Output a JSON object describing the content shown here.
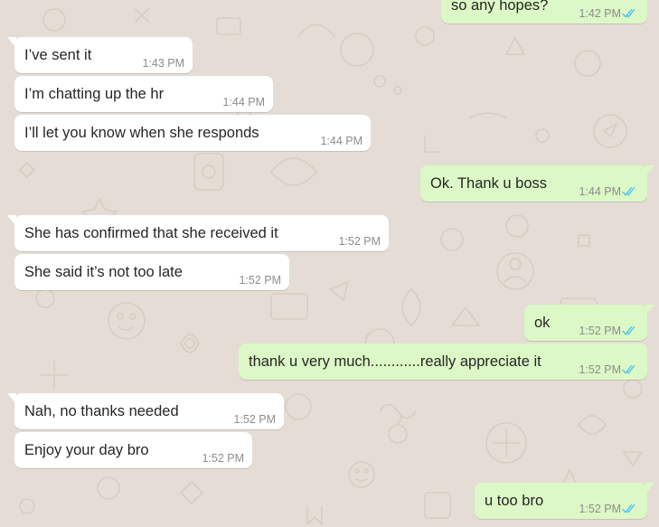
{
  "colors": {
    "wallpaper": "#e5ddd5",
    "incoming_bubble": "#ffffff",
    "outgoing_bubble": "#dcf8c6",
    "read_ticks": "#4fc3f7",
    "timestamp": "#8c8c8c"
  },
  "messages": [
    {
      "direction": "outgoing",
      "text": "so any hopes?",
      "time": "1:42 PM",
      "status": "read"
    },
    {
      "direction": "incoming",
      "text": "I’ve sent it",
      "time": "1:43 PM"
    },
    {
      "direction": "incoming",
      "text": "I’m chatting up the hr",
      "time": "1:44 PM"
    },
    {
      "direction": "incoming",
      "text": "I’ll let you know when she responds",
      "time": "1:44 PM"
    },
    {
      "direction": "outgoing",
      "text": "Ok. Thank u boss",
      "time": "1:44 PM",
      "status": "read"
    },
    {
      "direction": "incoming",
      "text": "She has confirmed that she received it",
      "time": "1:52 PM"
    },
    {
      "direction": "incoming",
      "text": "She said it’s not too late",
      "time": "1:52 PM"
    },
    {
      "direction": "outgoing",
      "text": "ok",
      "time": "1:52 PM",
      "status": "read"
    },
    {
      "direction": "outgoing",
      "text": "thank u very much............really appreciate it",
      "time": "1:52 PM",
      "status": "read"
    },
    {
      "direction": "incoming",
      "text": "Nah, no thanks needed",
      "time": "1:52 PM"
    },
    {
      "direction": "incoming",
      "text": "Enjoy your day bro",
      "time": "1:52 PM"
    },
    {
      "direction": "outgoing",
      "text": "u too bro",
      "time": "1:52 PM",
      "status": "read"
    }
  ]
}
